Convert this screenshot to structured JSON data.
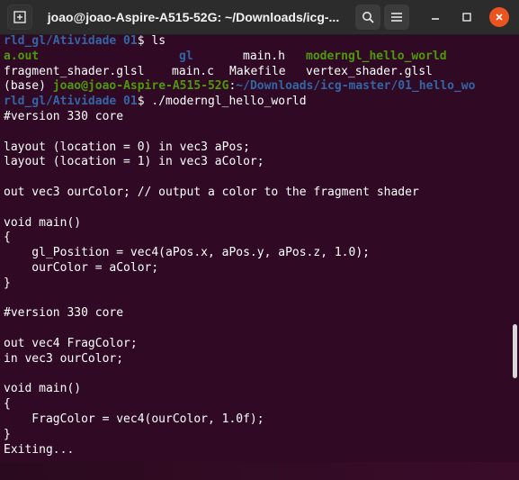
{
  "window": {
    "title": "joao@joao-Aspire-A515-52G: ~/Downloads/icg-...",
    "icons": {
      "new_tab": "new-tab-icon",
      "search": "search-icon",
      "menu": "hamburger-menu-icon",
      "minimize": "minimize-icon",
      "maximize": "maximize-icon",
      "close": "close-icon"
    },
    "colors": {
      "background": "#300a24",
      "prompt_user": "#4e9a06",
      "prompt_path": "#3465a4",
      "accent_close": "#e95420"
    }
  },
  "terminal": {
    "l1": {
      "path": "rld_gl/Atividade 01",
      "rest": "$ ls"
    },
    "l2": {
      "a": "a.out",
      "b": "gl",
      "c": "main.h",
      "d": "moderngl_hello_world"
    },
    "l3": {
      "a": "fragment_shader.glsl",
      "b": "main.c",
      "c": "Makefile",
      "d": "vertex_shader.glsl"
    },
    "l4": {
      "base": "(base) ",
      "user": "joao@joao-Aspire-A515-52G",
      "colon": ":",
      "path": "~/Downloads/icg-master/01_hello_wo"
    },
    "l5": {
      "path": "rld_gl/Atividade 01",
      "rest": "$ ./moderngl_hello_world"
    },
    "output": [
      "#version 330 core",
      "",
      "layout (location = 0) in vec3 aPos;",
      "layout (location = 1) in vec3 aColor;",
      "",
      "out vec3 ourColor; // output a color to the fragment shader",
      "",
      "void main()",
      "{",
      "    gl_Position = vec4(aPos.x, aPos.y, aPos.z, 1.0);",
      "    ourColor = aColor;",
      "}",
      "",
      "#version 330 core",
      "",
      "out vec4 FragColor;",
      "in vec3 ourColor;",
      "",
      "void main()",
      "{",
      "    FragColor = vec4(ourColor, 1.0f);",
      "}",
      "Exiting..."
    ]
  }
}
